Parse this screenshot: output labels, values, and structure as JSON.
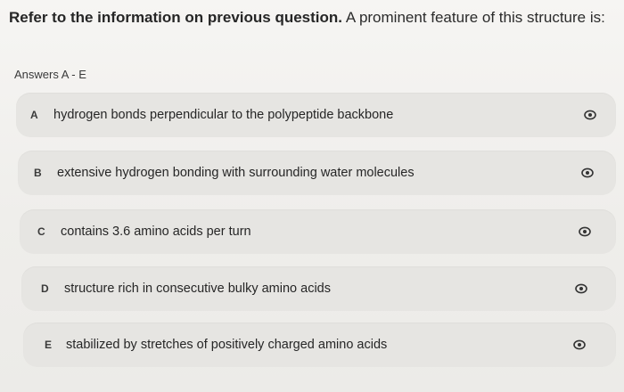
{
  "question": {
    "lead": "Refer to the information on previous question.",
    "rest": " A prominent feature of this structure is:"
  },
  "answers_label": "Answers A - E",
  "options": [
    {
      "letter": "A",
      "text": "hydrogen bonds perpendicular to the polypeptide backbone",
      "icon": "eye-icon"
    },
    {
      "letter": "B",
      "text": "extensive hydrogen bonding with surrounding water molecules",
      "icon": "eye-icon"
    },
    {
      "letter": "C",
      "text": "contains 3.6 amino acids per turn",
      "icon": "eye-icon"
    },
    {
      "letter": "D",
      "text": "structure rich in consecutive bulky amino acids",
      "icon": "eye-icon"
    },
    {
      "letter": "E",
      "text": "stabilized by stretches of positively charged amino acids",
      "icon": "eye-icon"
    }
  ],
  "colors": {
    "page_bg": "#f1efec",
    "option_bg": "#e6e5e2",
    "text": "#262626",
    "icon": "#333333"
  }
}
